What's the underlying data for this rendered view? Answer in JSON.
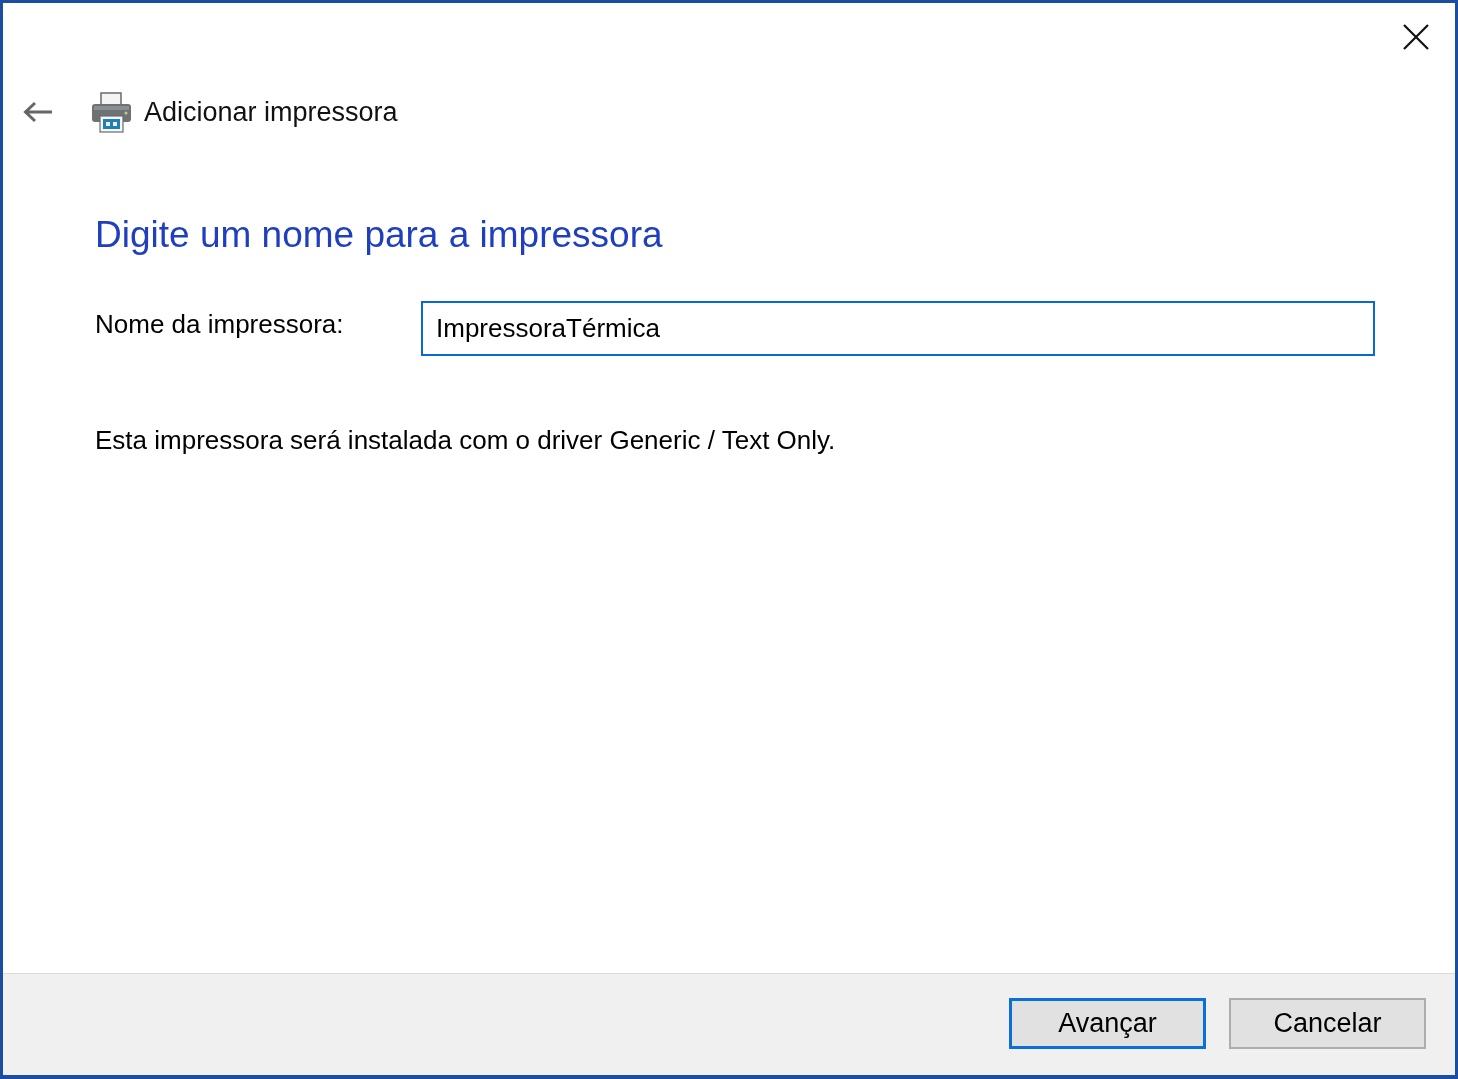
{
  "window": {
    "title": "Adicionar impressora"
  },
  "heading": "Digite um nome para a impressora",
  "name_field": {
    "label": "Nome da impressora:",
    "value": "ImpressoraTérmica",
    "focused": true
  },
  "description": "Esta impressora será instalada com o driver Generic / Text Only.",
  "buttons": [
    {
      "label": "Avançar",
      "default": true
    },
    {
      "label": "Cancelar",
      "default": false
    }
  ]
}
